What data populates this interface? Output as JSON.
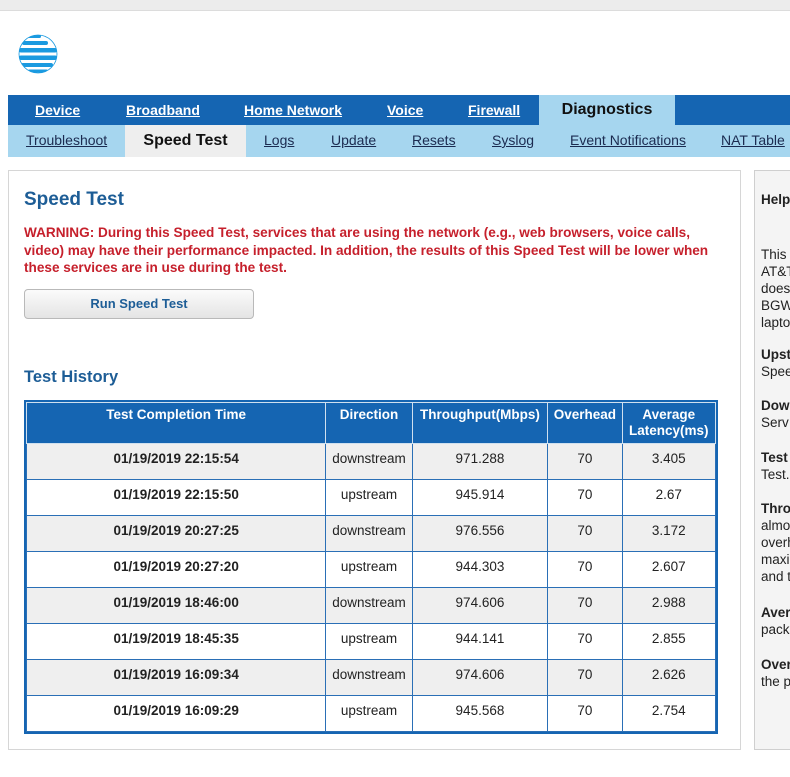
{
  "nav": {
    "main": [
      "Device",
      "Broadband",
      "Home Network",
      "Voice",
      "Firewall",
      "Diagnostics"
    ],
    "sub": [
      "Troubleshoot",
      "Speed Test",
      "Logs",
      "Update",
      "Resets",
      "Syslog",
      "Event Notifications",
      "NAT Table"
    ]
  },
  "page": {
    "title": "Speed Test",
    "warning": "WARNING: During this Speed Test, services that are using the network (e.g., web browsers, voice calls, video) may have their performance impacted. In addition, the results of this Speed Test will be lower when these services are in use during the test.",
    "run_button": "Run Speed Test",
    "history_title": "Test History"
  },
  "table": {
    "headers": [
      "Test Completion Time",
      "Direction",
      "Throughput(Mbps)",
      "Overhead",
      "Average Latency(ms)"
    ],
    "rows": [
      [
        "01/19/2019 22:15:54",
        "downstream",
        "971.288",
        "70",
        "3.405"
      ],
      [
        "01/19/2019 22:15:50",
        "upstream",
        "945.914",
        "70",
        "2.67"
      ],
      [
        "01/19/2019 20:27:25",
        "downstream",
        "976.556",
        "70",
        "3.172"
      ],
      [
        "01/19/2019 20:27:20",
        "upstream",
        "944.303",
        "70",
        "2.607"
      ],
      [
        "01/19/2019 18:46:00",
        "downstream",
        "974.606",
        "70",
        "2.988"
      ],
      [
        "01/19/2019 18:45:35",
        "upstream",
        "944.141",
        "70",
        "2.855"
      ],
      [
        "01/19/2019 16:09:34",
        "downstream",
        "974.606",
        "70",
        "2.626"
      ],
      [
        "01/19/2019 16:09:29",
        "upstream",
        "945.568",
        "70",
        "2.754"
      ]
    ]
  },
  "help": {
    "title": "Help",
    "lines": [
      {
        "text": "This",
        "bold": false
      },
      {
        "text": "AT&T",
        "bold": false
      },
      {
        "text": "does",
        "bold": false
      },
      {
        "text": "BGW",
        "bold": false
      },
      {
        "text": "lapto",
        "bold": false
      },
      {
        "text": "Upst",
        "bold": true
      },
      {
        "text": "Spee",
        "bold": false
      },
      {
        "text": "Dow",
        "bold": true
      },
      {
        "text": "Serv",
        "bold": false
      },
      {
        "text": "Test",
        "bold": true
      },
      {
        "text": "Test.",
        "bold": false
      },
      {
        "text": "Thro",
        "bold": true
      },
      {
        "text": "almo",
        "bold": false
      },
      {
        "text": "overh",
        "bold": false
      },
      {
        "text": "maxi",
        "bold": false
      },
      {
        "text": "and t",
        "bold": false
      },
      {
        "text": "Aver",
        "bold": true
      },
      {
        "text": "pack",
        "bold": false
      },
      {
        "text": "Over",
        "bold": true
      },
      {
        "text": "the p",
        "bold": false
      }
    ]
  },
  "colors": {
    "primary_blue": "#1565b2",
    "light_blue": "#a6d6ef",
    "warning_red": "#c6202c",
    "heading_blue": "#1d5d96"
  }
}
